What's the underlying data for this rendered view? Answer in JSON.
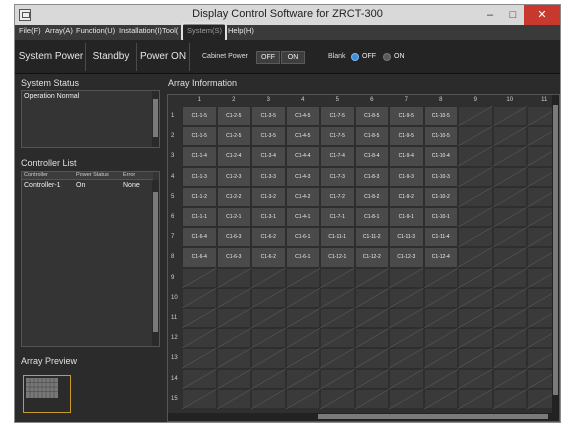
{
  "window": {
    "title": "Display Control Software for ZRCT-300"
  },
  "window_buttons": {
    "minimize": "–",
    "maximize": "□",
    "close": "✕"
  },
  "colors": {
    "accent": "#3b8fe0",
    "close": "#c7392f",
    "preview_border": "#c89b2a"
  },
  "menu": [
    {
      "label": "File(F)"
    },
    {
      "label": "Array(A)"
    },
    {
      "label": "Function(U)"
    },
    {
      "label": "Installation(I)"
    },
    {
      "label": "Tool("
    },
    {
      "label": "System(S)"
    },
    {
      "label": "Help(H)"
    }
  ],
  "toolbar": {
    "system_power": "System Power",
    "standby": "Standby",
    "power_on": "Power ON",
    "cabinet_power": "Cabinet Power",
    "cabinet_off": "OFF",
    "cabinet_on": "ON",
    "blank": "Blank",
    "blank_off": "OFF",
    "blank_on": "ON",
    "blank_selected": "OFF"
  },
  "system_status": {
    "title": "System Status",
    "text": "Operation Normal"
  },
  "controller_list": {
    "title": "Controller List",
    "columns": [
      "Controller",
      "Power Status",
      "Error"
    ],
    "rows": [
      {
        "controller": "Controller-1",
        "power_status": "On",
        "error": "None"
      }
    ]
  },
  "array_preview": {
    "title": "Array Preview"
  },
  "array_info": {
    "title": "Array Information",
    "col_headers": [
      "1",
      "2",
      "3",
      "4",
      "5",
      "6",
      "7",
      "8",
      "9",
      "10",
      "11"
    ],
    "row_headers": [
      "1",
      "2",
      "3",
      "4",
      "5",
      "6",
      "7",
      "8",
      "9",
      "10",
      "11",
      "12",
      "13",
      "14",
      "15"
    ],
    "rows": [
      [
        "C1-1-5",
        "C1-2-5",
        "C1-3-5",
        "C1-4-5",
        "C1-7-5",
        "C1-8-5",
        "C1-9-5",
        "C1-10-5"
      ],
      [
        "C1-1-5",
        "C1-2-5",
        "C1-3-5",
        "C1-4-5",
        "C1-7-5",
        "C1-8-5",
        "C1-9-5",
        "C1-10-5"
      ],
      [
        "C1-1-4",
        "C1-2-4",
        "C1-3-4",
        "C1-4-4",
        "C1-7-4",
        "C1-8-4",
        "C1-9-4",
        "C1-10-4"
      ],
      [
        "C1-1-3",
        "C1-2-3",
        "C1-3-3",
        "C1-4-3",
        "C1-7-3",
        "C1-8-3",
        "C1-9-3",
        "C1-10-3"
      ],
      [
        "C1-1-2",
        "C1-2-2",
        "C1-3-2",
        "C1-4-2",
        "C1-7-2",
        "C1-8-2",
        "C1-9-2",
        "C1-10-2"
      ],
      [
        "C1-1-1",
        "C1-2-1",
        "C1-3-1",
        "C1-4-1",
        "C1-7-1",
        "C1-8-1",
        "C1-9-1",
        "C1-10-1"
      ],
      [
        "C1-6-4",
        "C1-6-3",
        "C1-6-2",
        "C1-6-1",
        "C1-11-1",
        "C1-11-2",
        "C1-11-3",
        "C1-11-4"
      ],
      [
        "C1-6-4",
        "C1-6-3",
        "C1-6-2",
        "C1-6-1",
        "C1-12-1",
        "C1-12-2",
        "C1-12-3",
        "C1-12-4"
      ]
    ]
  }
}
